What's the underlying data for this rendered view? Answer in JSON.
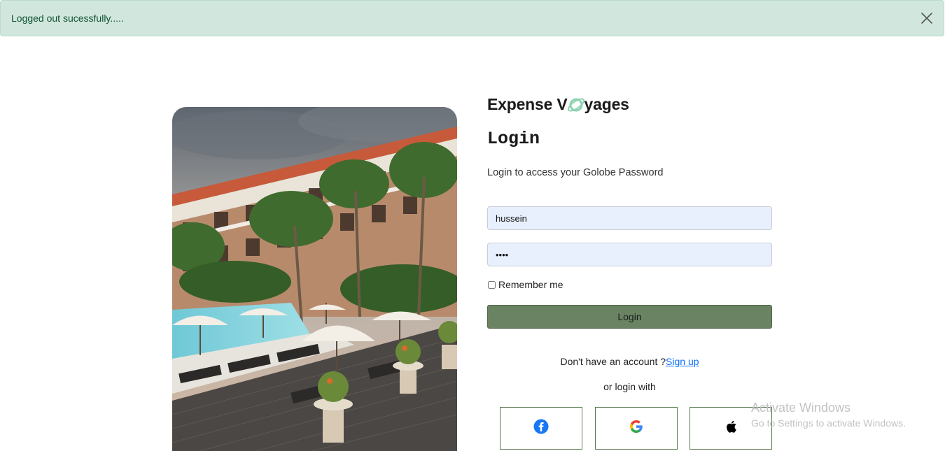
{
  "alert": {
    "message": "Logged out sucessfully.....",
    "close_icon": "close-icon"
  },
  "brand": {
    "part1": "Expense V",
    "part2": "yages",
    "logo_icon": "planet-icon",
    "accent": "#8fd3b0"
  },
  "login": {
    "title": "Login",
    "subtitle": "Login to access your Golobe Password",
    "username_value": "hussein",
    "password_value": "••••",
    "remember_label": "Remember me",
    "remember_checked": false,
    "button_label": "Login",
    "button_color": "#6a8463",
    "signup_prompt": "Don't have an account ?",
    "signup_link": "Sign up",
    "or_text": "or login with"
  },
  "social": [
    {
      "name": "facebook",
      "icon": "facebook-icon",
      "color": "#1877f2"
    },
    {
      "name": "google",
      "icon": "google-icon"
    },
    {
      "name": "apple",
      "icon": "apple-icon",
      "color": "#000000"
    }
  ],
  "watermark": {
    "line1": "Activate Windows",
    "line2": "Go to Settings to activate Windows."
  }
}
